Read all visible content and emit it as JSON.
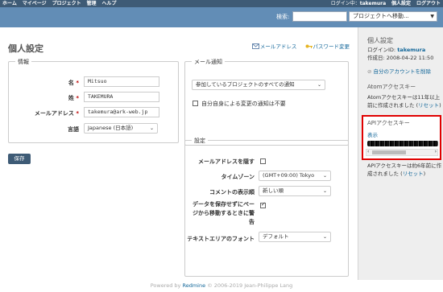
{
  "top_menu": {
    "left_items": [
      "ホーム",
      "マイページ",
      "プロジェクト",
      "管理",
      "ヘルプ"
    ],
    "logged_as_label": "ログイン中：",
    "logged_user": "takemura",
    "right_items": [
      "個人設定",
      "ログアウト"
    ]
  },
  "header": {
    "search_label": "検索:",
    "search_value": "",
    "project_jump": "プロジェクトへ移動..."
  },
  "page": {
    "title": "個人設定",
    "contextual_links": [
      "メールアドレス",
      "パスワード変更"
    ]
  },
  "info_fieldset": {
    "legend": "情報",
    "fields": [
      {
        "label": "名",
        "required": true,
        "value": "Mitsuo"
      },
      {
        "label": "姓",
        "required": true,
        "value": "TAKEMURA"
      },
      {
        "label": "メールアドレス",
        "required": true,
        "value": "takemura@ark-web.jp"
      }
    ],
    "language_label": "言語",
    "language_value": "Japanese (日本語)",
    "required_mark": "*"
  },
  "mail_fieldset": {
    "legend": "メール通知",
    "notification_value": "参加しているプロジェクトのすべての通知",
    "no_self_notified_label": "自分自身による変更の通知は不要",
    "no_self_notified_checked": false
  },
  "settings_fieldset": {
    "legend": "設定",
    "hide_mail_label": "メールアドレスを隠す",
    "hide_mail_checked": false,
    "timezone_label": "タイムゾーン",
    "timezone_value": "(GMT+09:00) Tokyo",
    "comments_order_label": "コメントの表示順",
    "comments_order_value": "新しい順",
    "warn_unsaved_label": "データを保存せずにページから移動するときに警告",
    "warn_unsaved_checked": true,
    "textarea_font_label": "テキストエリアのフォント",
    "textarea_font_value": "デフォルト"
  },
  "save_button": "保存",
  "sidebar": {
    "title": "個人設定",
    "login_label": "ログインID:",
    "login_id": "takemura",
    "created_label": "作成日: 2008-04-22 11:50",
    "delete_account": "自分のアカウントを削除",
    "atom_title": "Atomアクセスキー",
    "atom_text": "Atomアクセスキーは11年以上前に作成されました (",
    "atom_reset": "リセット",
    "api_title": "APIアクセスキー",
    "api_show": "表示",
    "api_text": "APIアクセスキーは約6年前に作成されました (",
    "api_reset": "リセット",
    "close_paren": ")"
  },
  "footer": {
    "prefix": "Powered by",
    "brand": "Redmine",
    "suffix": "© 2006-2019 Jean-Philippe Lang"
  },
  "colors": {
    "top_menu_bg": "#3E5B76",
    "header_bg": "#628DB6",
    "link": "#116699",
    "highlight_box": "#E00000"
  }
}
